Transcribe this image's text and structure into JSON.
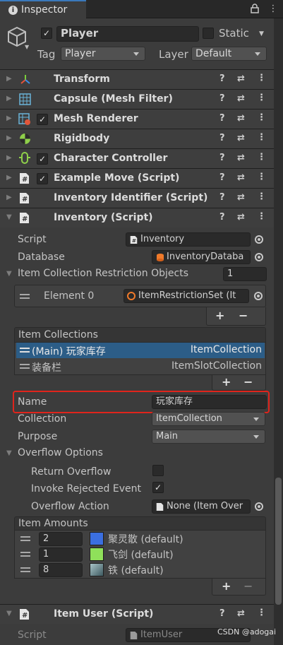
{
  "window": {
    "tab_label": "Inspector"
  },
  "object": {
    "name": "Player",
    "static_label": "Static",
    "tag_label": "Tag",
    "tag_value": "Player",
    "layer_label": "Layer",
    "layer_value": "Default"
  },
  "components": [
    {
      "title": "Transform"
    },
    {
      "title": "Capsule (Mesh Filter)"
    },
    {
      "title": "Mesh Renderer"
    },
    {
      "title": "Rigidbody"
    },
    {
      "title": "Character Controller"
    },
    {
      "title": "Example Move (Script)"
    },
    {
      "title": "Inventory Identifier (Script)"
    },
    {
      "title": "Inventory (Script)"
    },
    {
      "title": "Item User (Script)"
    }
  ],
  "inventory": {
    "script_label": "Script",
    "script_value": "Inventory",
    "database_label": "Database",
    "database_value": "InventoryDataba",
    "restriction_label": "Item Collection Restriction Objects",
    "restriction_count": "1",
    "element_label": "Element 0",
    "element_value": "ItemRestrictionSet (It",
    "collections_header": "Item Collections",
    "collections": [
      {
        "name": "(Main) 玩家库存",
        "type": "ItemCollection"
      },
      {
        "name": "装备栏",
        "type": "ItemSlotCollection"
      }
    ],
    "name_label": "Name",
    "name_value": "玩家库存",
    "collection_label": "Collection",
    "collection_value": "ItemCollection",
    "purpose_label": "Purpose",
    "purpose_value": "Main",
    "overflow_label": "Overflow Options",
    "return_overflow_label": "Return Overflow",
    "invoke_rejected_label": "Invoke Rejected Event",
    "overflow_action_label": "Overflow Action",
    "overflow_action_value": "None (Item Over",
    "amounts_header": "Item Amounts",
    "amounts": [
      {
        "amount": "2",
        "item": "聚灵散 (default)",
        "color": "#3b6fe0"
      },
      {
        "amount": "1",
        "item": "飞剑 (default)",
        "color": "#8fe05a"
      },
      {
        "amount": "8",
        "item": "铁 (default)",
        "color": "#6c8f96"
      }
    ]
  },
  "item_user": {
    "script_label": "Script",
    "script_value": "ItemUser"
  },
  "watermark": "CSDN @adogai",
  "colors": {
    "accent": "#3a79bb",
    "highlight_box": "#e0241c",
    "selected_row": "#2c5d87"
  }
}
